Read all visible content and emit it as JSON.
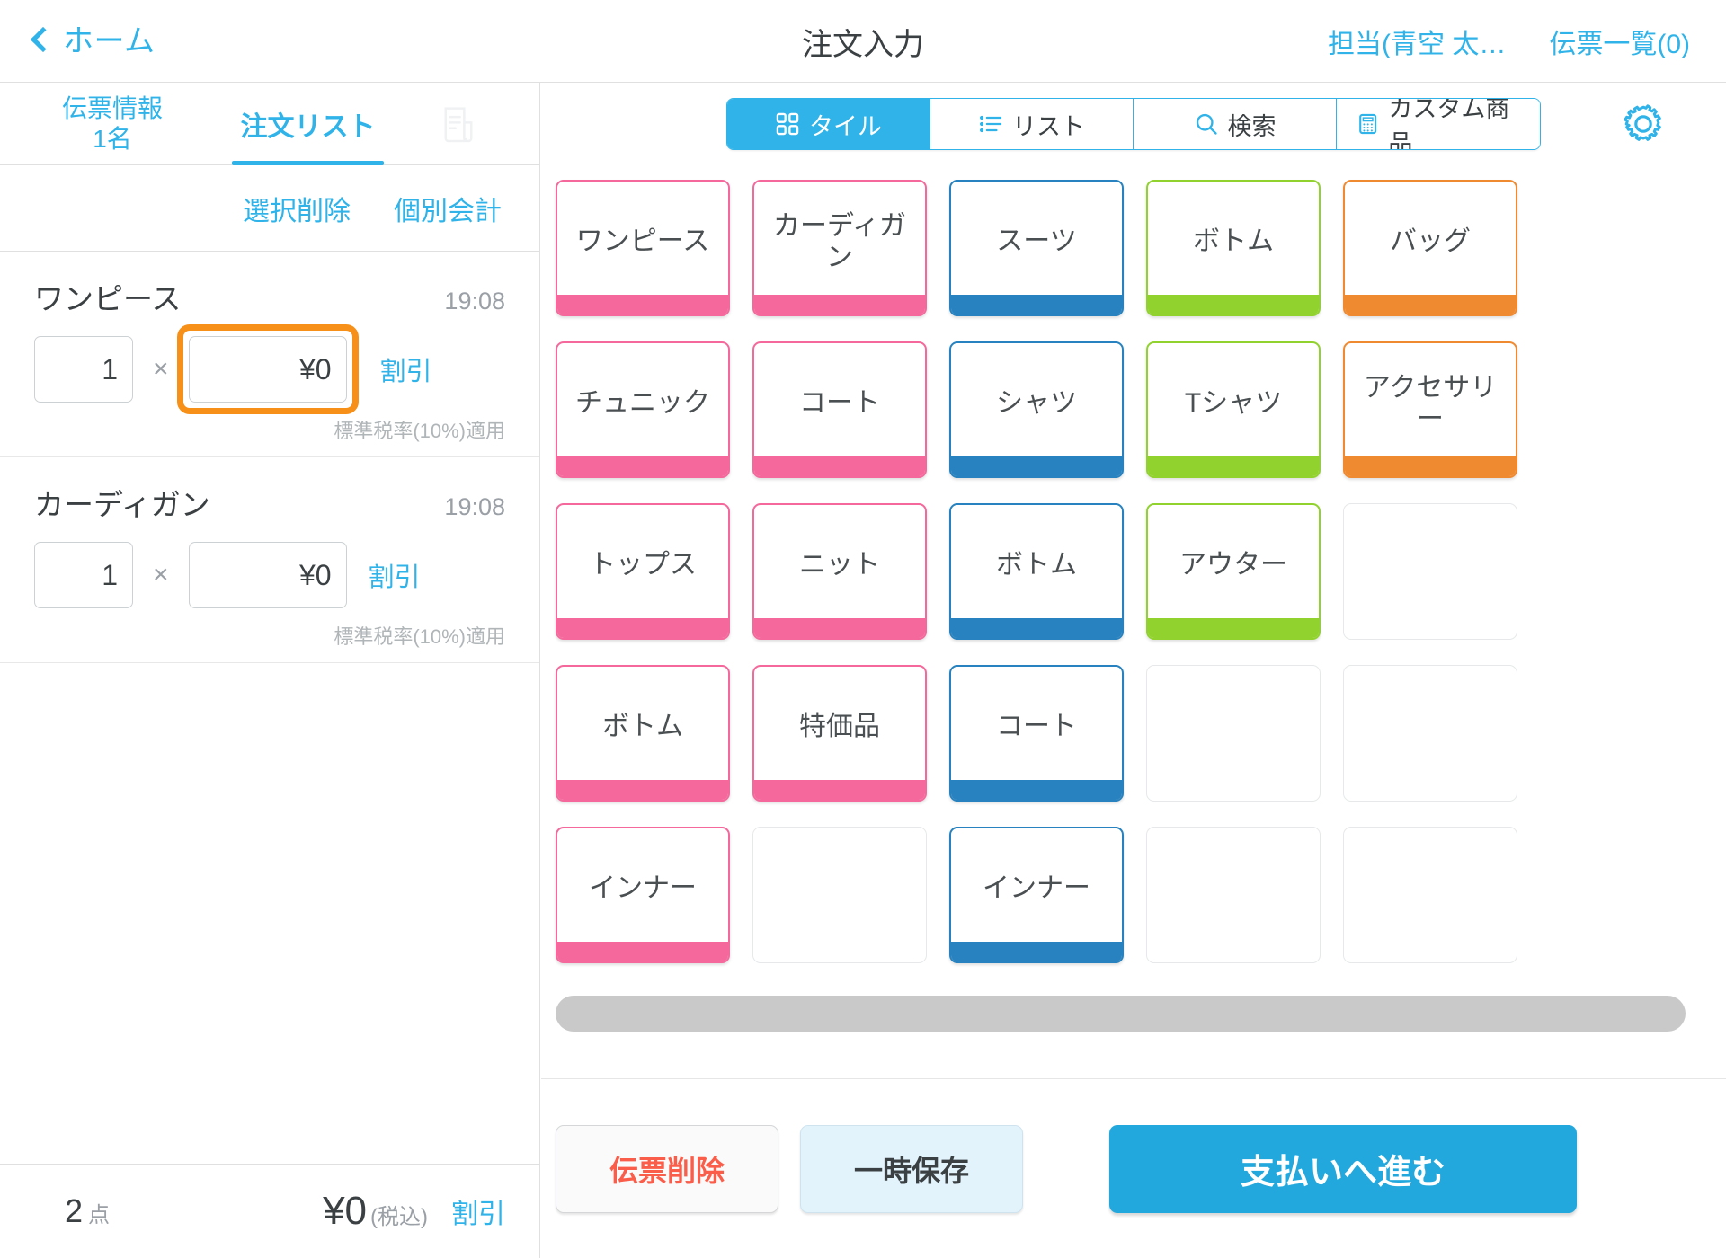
{
  "header": {
    "back_label": "ホーム",
    "back_icon": "chevron-left-icon",
    "title": "注文入力",
    "staff": "担当(青空 太…",
    "slip_list": "伝票一覧(0)"
  },
  "left_panel": {
    "tabs": [
      {
        "label": "伝票情報",
        "sub": "1名",
        "active": false
      },
      {
        "label": "注文リスト",
        "active": true
      },
      {
        "icon": "receipt-icon",
        "active": false,
        "disabled": true
      }
    ],
    "actions": {
      "delete_selected": "選択削除",
      "individual_checkout": "個別会計"
    },
    "items": [
      {
        "name": "ワンピース",
        "time": "19:08",
        "qty": "1",
        "multiply": "×",
        "price": "¥0",
        "discount": "割引",
        "tax_note": "標準税率(10%)適用",
        "focused": true
      },
      {
        "name": "カーディガン",
        "time": "19:08",
        "qty": "1",
        "multiply": "×",
        "price": "¥0",
        "discount": "割引",
        "tax_note": "標準税率(10%)適用",
        "focused": false
      }
    ],
    "total": {
      "count": "2",
      "count_unit": "点",
      "amount": "¥0",
      "tax_incl": "(税込)",
      "discount": "割引"
    }
  },
  "right_panel": {
    "view_tabs": [
      {
        "label": "タイル",
        "icon": "grid-icon",
        "active": true
      },
      {
        "label": "リスト",
        "icon": "list-icon",
        "active": false
      },
      {
        "label": "検索",
        "icon": "search-icon",
        "active": false
      },
      {
        "label": "カスタム商品",
        "icon": "calculator-icon",
        "active": false
      }
    ],
    "settings_icon": "gear-icon",
    "tiles": [
      {
        "label": "ワンピース",
        "color": "#f4689b"
      },
      {
        "label": "カーディガン",
        "color": "#f4689b"
      },
      {
        "label": "スーツ",
        "color": "#2782bf"
      },
      {
        "label": "ボトム",
        "color": "#92d22e"
      },
      {
        "label": "バッグ",
        "color": "#f08a31"
      },
      {
        "label": "",
        "color": ""
      },
      {
        "label": "チュニック",
        "color": "#f4689b"
      },
      {
        "label": "コート",
        "color": "#f4689b"
      },
      {
        "label": "シャツ",
        "color": "#2782bf"
      },
      {
        "label": "Tシャツ",
        "color": "#92d22e"
      },
      {
        "label": "アクセサリー",
        "color": "#f08a31"
      },
      {
        "label": "",
        "color": ""
      },
      {
        "label": "トップス",
        "color": "#f4689b"
      },
      {
        "label": "ニット",
        "color": "#f4689b"
      },
      {
        "label": "ボトム",
        "color": "#2782bf"
      },
      {
        "label": "アウター",
        "color": "#92d22e"
      },
      {
        "label": "",
        "color": ""
      },
      {
        "label": "",
        "color": ""
      },
      {
        "label": "ボトム",
        "color": "#f4689b"
      },
      {
        "label": "特価品",
        "color": "#f4689b"
      },
      {
        "label": "コート",
        "color": "#2782bf"
      },
      {
        "label": "",
        "color": ""
      },
      {
        "label": "",
        "color": ""
      },
      {
        "label": "",
        "color": ""
      },
      {
        "label": "インナー",
        "color": "#f4689b"
      },
      {
        "label": "",
        "color": ""
      },
      {
        "label": "インナー",
        "color": "#2782bf"
      },
      {
        "label": "",
        "color": ""
      },
      {
        "label": "",
        "color": ""
      },
      {
        "label": "",
        "color": ""
      }
    ],
    "scrollbar": "horizontal-scrollbar",
    "buttons": {
      "delete_slip": "伝票削除",
      "hold": "一時保存",
      "proceed_payment": "支払いへ進む"
    }
  },
  "colors": {
    "accent_blue": "#30b3e8",
    "pay_blue": "#23a8dd",
    "focus_orange": "#f79019",
    "danger_red": "#fa5e4b"
  }
}
